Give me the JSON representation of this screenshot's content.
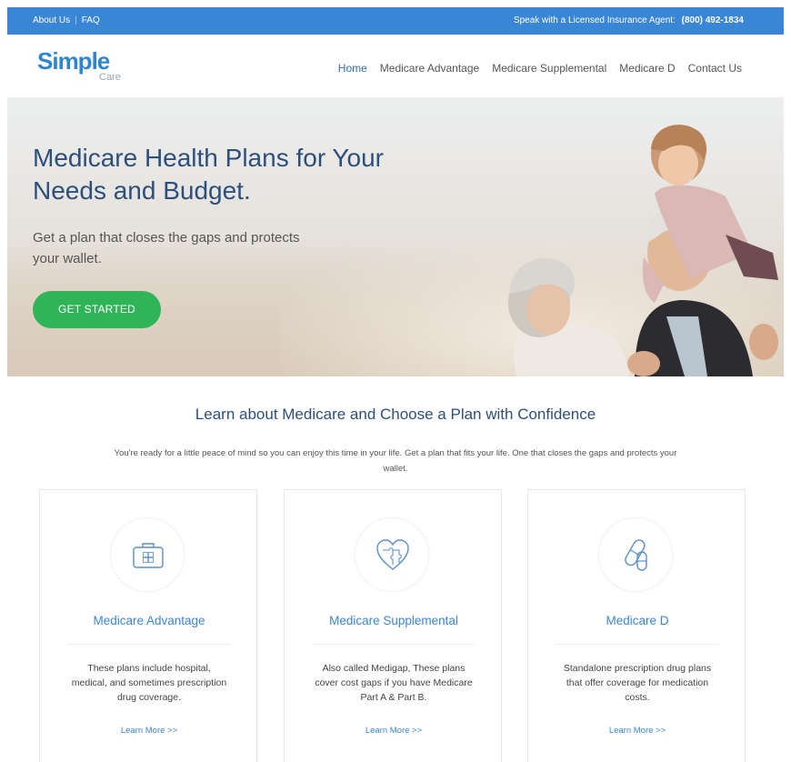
{
  "topbar": {
    "about": "About Us",
    "faq": "FAQ",
    "agent_text": "Speak with a Licensed Insurance Agent:",
    "phone": "(800) 492-1834"
  },
  "logo": {
    "main": "Simple",
    "sub": "Care"
  },
  "nav": {
    "home": "Home",
    "advantage": "Medicare Advantage",
    "supplemental": "Medicare Supplemental",
    "d": "Medicare D",
    "contact": "Contact Us"
  },
  "hero": {
    "title": "Medicare Health Plans for Your Needs and Budget.",
    "subtitle": "Get a plan that closes the gaps and protects your wallet.",
    "cta": "GET STARTED"
  },
  "section": {
    "title": "Learn about Medicare and Choose a Plan with Confidence",
    "text": "You're ready for a little peace of mind so you can enjoy this time in your life. Get a plan that fits your life. One that closes the gaps and protects your wallet."
  },
  "cards": [
    {
      "icon": "medical-kit-icon",
      "title": "Medicare Advantage",
      "desc": "These plans include hospital, medical, and sometimes prescription drug coverage.",
      "link": "Learn More >>"
    },
    {
      "icon": "heart-puzzle-icon",
      "title": "Medicare Supplemental",
      "desc": "Also called Medigap, These plans cover cost gaps if you have Medicare Part A & Part B.",
      "link": "Learn More >>"
    },
    {
      "icon": "pills-icon",
      "title": "Medicare D",
      "desc": "Standalone prescription drug plans that offer coverage for medication costs.",
      "link": "Learn More >>"
    }
  ],
  "colors": {
    "topbar": "#3a86d6",
    "brand_blue": "#2f86d0",
    "heading": "#2d4f7c",
    "cta_green": "#2fb457",
    "link": "#3a86d6"
  }
}
